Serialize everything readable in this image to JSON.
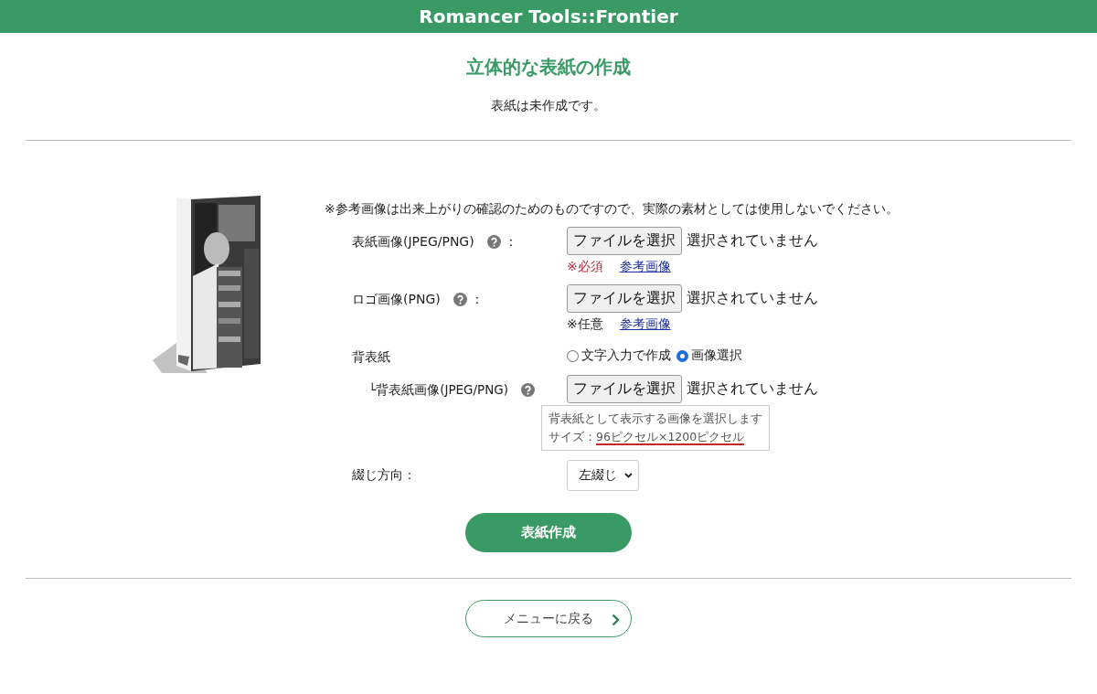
{
  "header": {
    "title": "Romancer Tools::Frontier"
  },
  "page_title": "立体的な表紙の作成",
  "status_message": "表紙は未作成です。",
  "note": "※参考画像は出来上がりの確認のためのものですので、実際の素材としては使用しないでください。",
  "fields": [
    {
      "kind": "file",
      "label": "表紙画像(JPEG/PNG)",
      "help": true,
      "colon": "：",
      "button": "ファイルを選択",
      "file_status": "選択されていません",
      "requirement": "※必須",
      "required": true,
      "link": "参考画像"
    },
    {
      "kind": "file",
      "label": "ロゴ画像(PNG)",
      "help": true,
      "colon": "：",
      "button": "ファイルを選択",
      "file_status": "選択されていません",
      "requirement": "※任意",
      "required": false,
      "link": "参考画像"
    },
    {
      "kind": "radio",
      "label": "背表紙",
      "options": [
        {
          "label": "文字入力で作成",
          "selected": false
        },
        {
          "label": "画像選択",
          "selected": true
        }
      ]
    },
    {
      "kind": "file",
      "label": "└背表紙画像(JPEG/PNG)",
      "sub": true,
      "help": true,
      "button": "ファイルを選択",
      "file_status": "選択されていません",
      "tooltip": {
        "line": "背表紙として表示する画像を選択します",
        "size_label": "サイズ：",
        "size_value": "96ピクセル×1200ピクセル"
      }
    },
    {
      "kind": "select",
      "label": "綴じ方向：",
      "value": "左綴じ"
    }
  ],
  "submit_button": "表紙作成",
  "back_button": "メニューに戻る"
}
